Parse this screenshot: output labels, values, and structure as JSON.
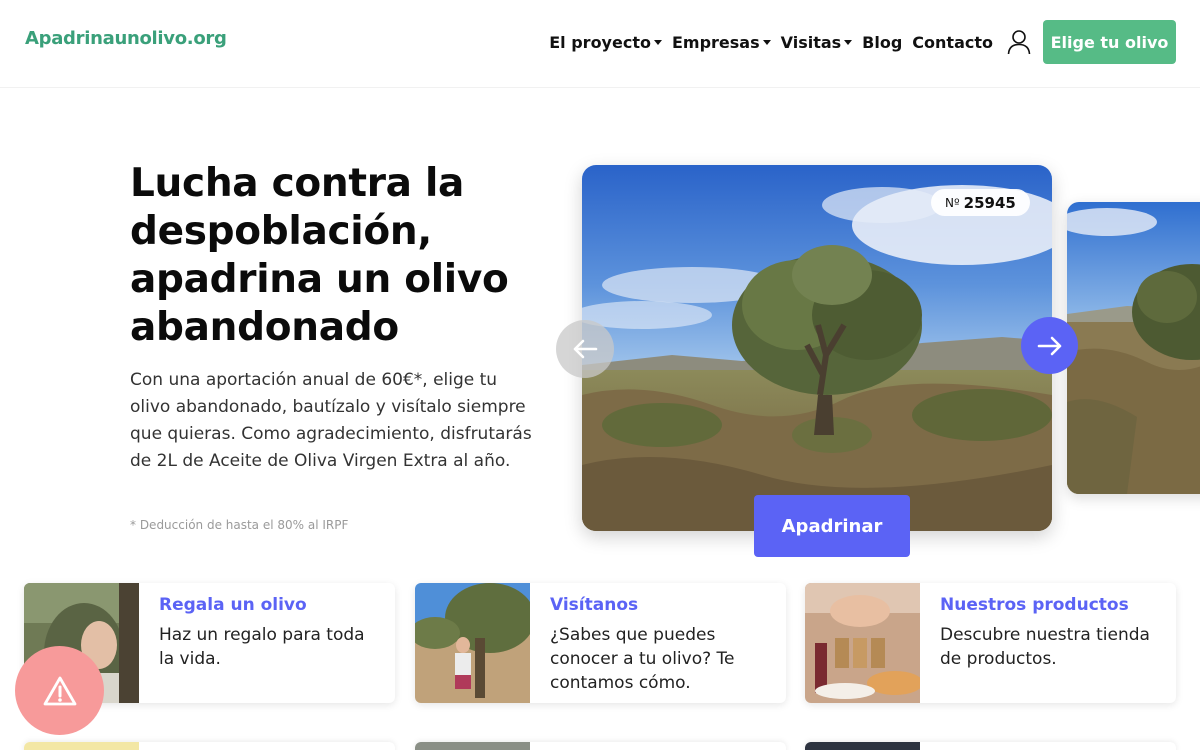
{
  "header": {
    "logo": "Apadrinaunolivo.org",
    "nav": [
      {
        "label": "El proyecto",
        "dropdown": true
      },
      {
        "label": "Empresas",
        "dropdown": true
      },
      {
        "label": "Visitas",
        "dropdown": true
      },
      {
        "label": "Blog",
        "dropdown": false
      },
      {
        "label": "Contacto",
        "dropdown": false
      }
    ],
    "user_icon": "user-icon",
    "cta": "Elige tu olivo"
  },
  "hero": {
    "title": "Lucha contra la despoblación, apadrina un olivo abandonado",
    "text": "Con una aportación anual de 60€*, elige tu olivo abandonado, bautízalo y visítalo siempre que quieras. Como agradecimiento, disfrutarás de 2L de Aceite de Oliva Virgen Extra al año.",
    "note": "* Deducción de hasta el 80% al IRPF"
  },
  "carousel": {
    "badge_label": "Nº",
    "badge_number": "25945",
    "prev_icon": "arrow-left-icon",
    "next_icon": "arrow-right-icon",
    "button": "Apadrinar"
  },
  "cards": [
    {
      "title": "Regala un olivo",
      "text": "Haz un regalo para toda la vida."
    },
    {
      "title": "Visítanos",
      "text": "¿Sabes que puedes conocer a tu olivo? Te contamos cómo."
    },
    {
      "title": "Nuestros productos",
      "text": "Descubre nuestra tienda de productos."
    }
  ],
  "alert": {
    "icon": "warning-icon"
  },
  "colors": {
    "brand_green": "#56bb86",
    "logo_green": "#3aa07a",
    "accent_blue": "#5b63f5",
    "alert_red": "#f79a9a"
  }
}
